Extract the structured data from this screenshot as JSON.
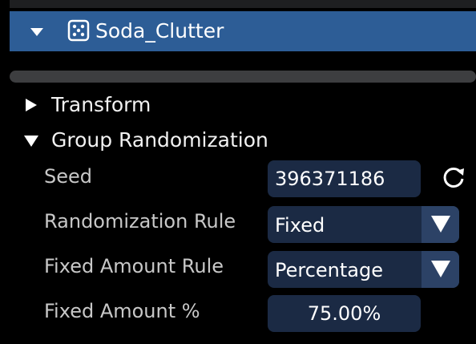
{
  "header": {
    "title": "Soda_Clutter",
    "header_color": "#2d5d96"
  },
  "sections": {
    "transform": {
      "label": "Transform",
      "expanded": false
    },
    "group_randomization": {
      "label": "Group Randomization",
      "expanded": true
    }
  },
  "properties": {
    "seed": {
      "label": "Seed",
      "value": "396371186"
    },
    "randomization_rule": {
      "label": "Randomization Rule",
      "value": "Fixed"
    },
    "fixed_amount_rule": {
      "label": "Fixed Amount Rule",
      "value": "Percentage"
    },
    "fixed_amount_percent": {
      "label": "Fixed Amount %",
      "value": "75.00%"
    }
  },
  "icons": {
    "collapse": "triangle-down-icon",
    "prim": "dice-icon",
    "refresh": "refresh-icon",
    "dropdown_arrow": "triangle-down-icon"
  },
  "colors": {
    "background": "#000000",
    "field": "#1b2a44",
    "dropdown_button": "#2c4266",
    "label_text": "#c8c8c8"
  }
}
